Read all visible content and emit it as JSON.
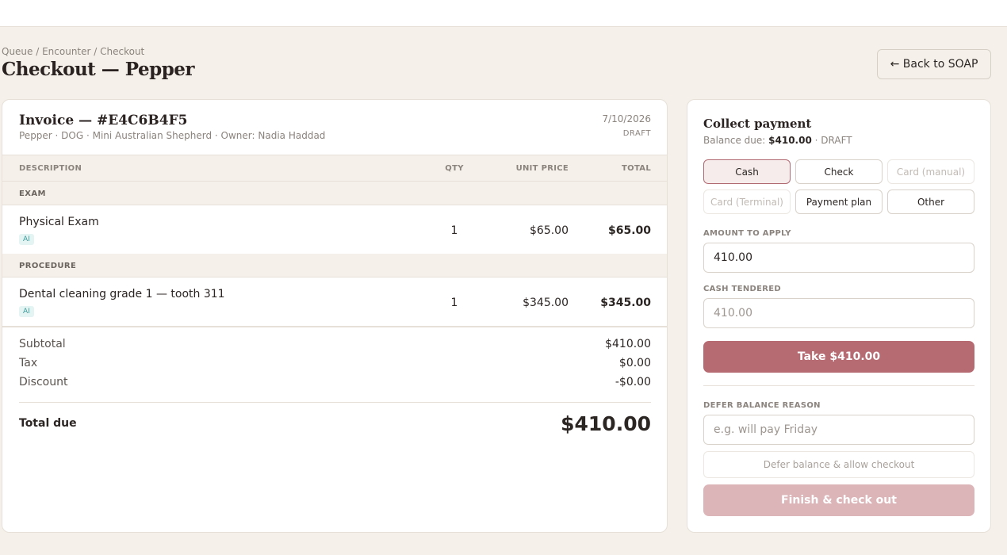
{
  "header": {
    "breadcrumb": "Queue / Encounter / Checkout",
    "title": "Checkout — Pepper",
    "back_label": "← Back to SOAP"
  },
  "invoice": {
    "title": "Invoice — #E4C6B4F5",
    "subtitle": "Pepper · DOG · Mini Australian Shepherd · Owner: Nadia Haddad",
    "date": "7/10/2026",
    "status": "DRAFT",
    "columns": {
      "description": "DESCRIPTION",
      "qty": "QTY",
      "unit_price": "UNIT PRICE",
      "total": "TOTAL"
    },
    "sections": [
      {
        "label": "EXAM",
        "items": [
          {
            "name": "Physical Exam",
            "badge": "AI",
            "qty": "1",
            "unit_price": "$65.00",
            "total": "$65.00"
          }
        ]
      },
      {
        "label": "PROCEDURE",
        "items": [
          {
            "name": "Dental cleaning grade 1 — tooth 311",
            "badge": "AI",
            "qty": "1",
            "unit_price": "$345.00",
            "total": "$345.00"
          }
        ]
      }
    ],
    "totals": {
      "subtotal_label": "Subtotal",
      "subtotal": "$410.00",
      "tax_label": "Tax",
      "tax": "$0.00",
      "discount_label": "Discount",
      "discount": "-$0.00",
      "total_due_label": "Total due",
      "total_due": "$410.00"
    }
  },
  "payment": {
    "title": "Collect payment",
    "balance_label": "Balance due:",
    "balance_value": "$410.00",
    "balance_status": "· DRAFT",
    "methods": [
      {
        "label": "Cash",
        "state": "active"
      },
      {
        "label": "Check",
        "state": "enabled"
      },
      {
        "label": "Card (manual)",
        "state": "disabled"
      },
      {
        "label": "Card (Terminal)",
        "state": "disabled"
      },
      {
        "label": "Payment plan",
        "state": "enabled"
      },
      {
        "label": "Other",
        "state": "enabled"
      }
    ],
    "amount_label": "AMOUNT TO APPLY",
    "amount_value": "410.00",
    "cash_label": "CASH TENDERED",
    "cash_placeholder": "410.00",
    "take_label": "Take $410.00",
    "defer_label": "DEFER BALANCE REASON",
    "defer_placeholder": "e.g. will pay Friday",
    "defer_button": "Defer balance & allow checkout",
    "finish_button": "Finish & check out"
  },
  "colors": {
    "accent": "#b66a72",
    "accent_disabled": "#dcb5b9",
    "background": "#f5f1ea",
    "ai_badge": "#3a9a9a"
  }
}
